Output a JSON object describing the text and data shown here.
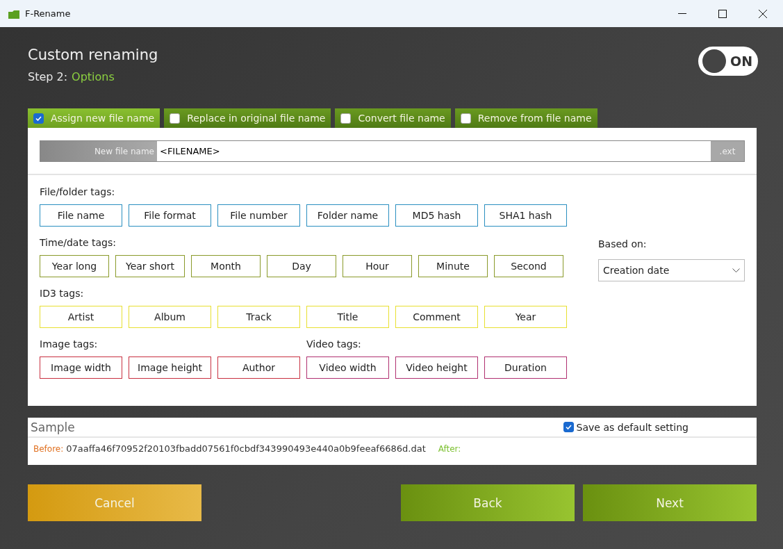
{
  "window": {
    "title": "F-Rename"
  },
  "header": {
    "title": "Custom renaming",
    "step_label": "Step 2:",
    "step_name": "Options",
    "toggle": {
      "label": "ON",
      "on": true
    }
  },
  "tabs": [
    {
      "label": "Assign new file name",
      "selected": true,
      "checked": true
    },
    {
      "label": "Replace in original file name",
      "selected": false,
      "checked": false
    },
    {
      "label": "Convert file name",
      "selected": false,
      "checked": false
    },
    {
      "label": "Remove from file name",
      "selected": false,
      "checked": false
    }
  ],
  "name_field": {
    "label": "New file name",
    "value": "<FILENAME>",
    "suffix": ".ext"
  },
  "tag_groups": [
    {
      "title": "File/folder tags:",
      "color": "#2a8fc0",
      "tags": [
        "File name",
        "File format",
        "File number",
        "Folder name",
        "MD5 hash",
        "SHA1 hash"
      ]
    },
    {
      "title": "Time/date tags:",
      "color": "#8a9a2a",
      "tags": [
        "Year long",
        "Year short",
        "Month",
        "Day",
        "Hour",
        "Minute",
        "Second"
      ]
    },
    {
      "title": "ID3 tags:",
      "color": "#e8e030",
      "tags": [
        "Artist",
        "Album",
        "Track",
        "Title",
        "Comment",
        "Year"
      ]
    },
    {
      "title": "Image tags:",
      "color": "#c83040",
      "tags": [
        "Image width",
        "Image height",
        "Author"
      ]
    },
    {
      "title": "Video tags:",
      "color": "#b03070",
      "tags": [
        "Video width",
        "Video height",
        "Duration"
      ]
    }
  ],
  "based_on": {
    "label": "Based on:",
    "value": "Creation date"
  },
  "sample": {
    "title": "Sample",
    "save_default": {
      "label": "Save as default setting",
      "checked": true
    },
    "before_label": "Before:",
    "before_value": "07aaffa46f70952f20103fbadd07561f0cbdf343990493e440a0b9feeaf6686d.dat",
    "after_label": "After:"
  },
  "buttons": [
    {
      "label": "Cancel",
      "kind": "cancel"
    },
    {
      "label": "Back",
      "kind": "nav"
    },
    {
      "label": "Next",
      "kind": "nav"
    }
  ]
}
